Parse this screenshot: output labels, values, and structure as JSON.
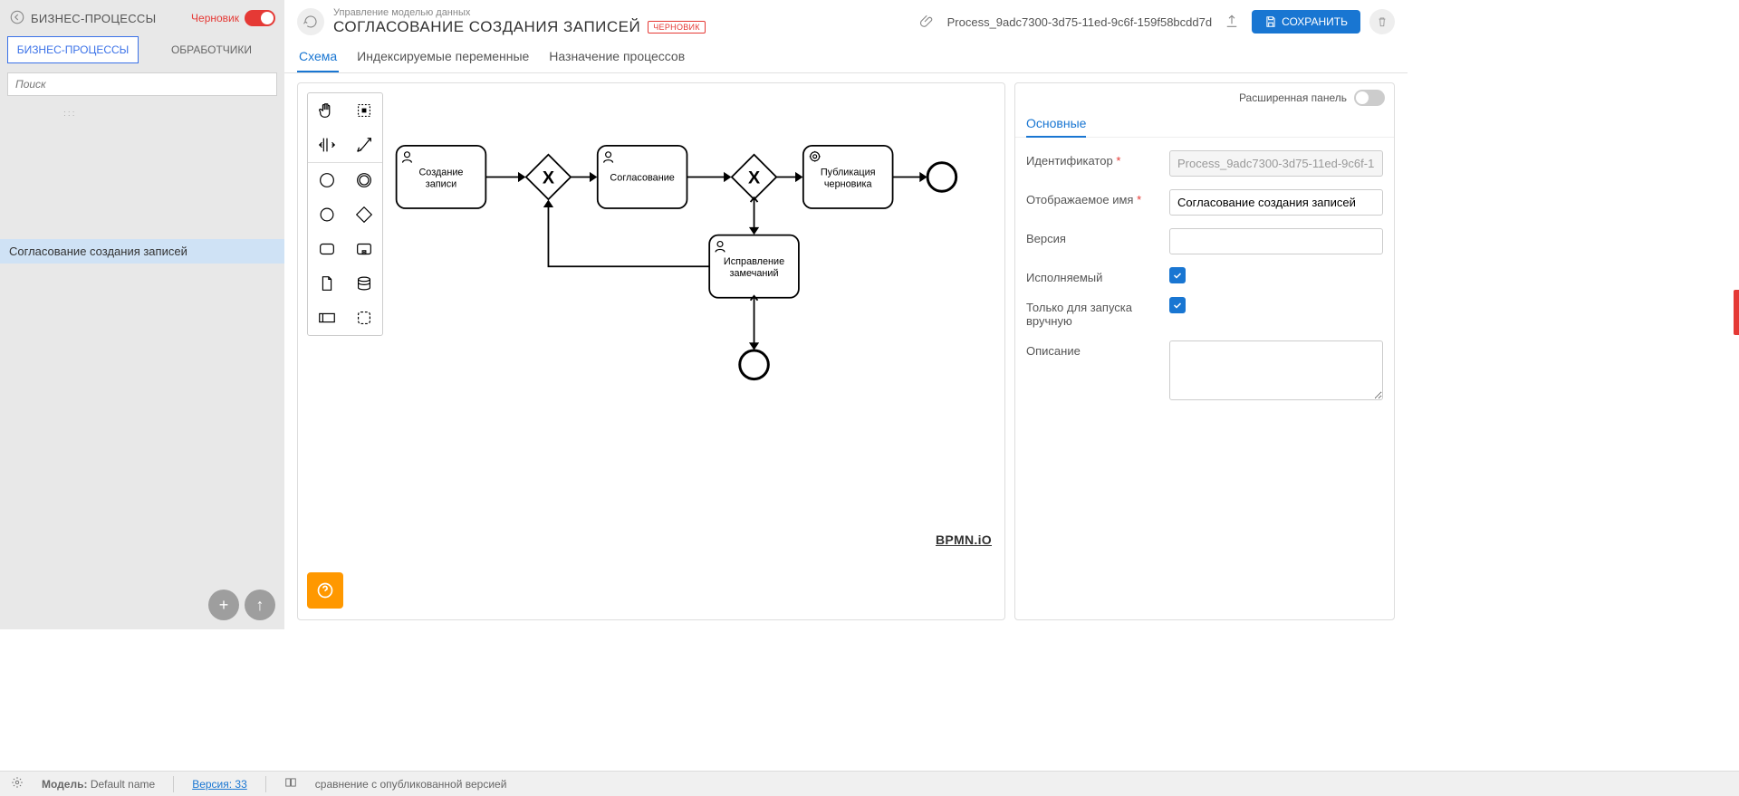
{
  "sidebar": {
    "title": "БИЗНЕС-ПРОЦЕССЫ",
    "draft_label": "Черновик",
    "tabs": [
      "БИЗНЕС-ПРОЦЕССЫ",
      "ОБРАБОТЧИКИ"
    ],
    "search_placeholder": "Поиск",
    "tree_items": [
      "Согласование создания записей"
    ]
  },
  "header": {
    "breadcrumb": "Управление моделью данных",
    "title": "СОГЛАСОВАНИЕ СОЗДАНИЯ ЗАПИСЕЙ",
    "badge": "ЧЕРНОВИК",
    "process_file": "Process_9adc7300-3d75-11ed-9c6f-159f58bcdd7d",
    "save": "СОХРАНИТЬ"
  },
  "tabs": [
    "Схема",
    "Индексируемые переменные",
    "Назначение процессов"
  ],
  "palette_tooltips": {
    "hand": "hand-tool",
    "lasso": "lasso-tool",
    "space": "space-tool",
    "connect": "global-connect-tool",
    "start-event": "start-event",
    "end-event": "end-event",
    "intermediate-event": "intermediate-event",
    "gateway": "gateway",
    "task": "task",
    "subprocess": "subprocess",
    "data-object": "data-object",
    "data-store": "data-store",
    "participant": "participant",
    "group": "group"
  },
  "bpmn": {
    "nodes": {
      "task1_l1": "Создание",
      "task1_l2": "записи",
      "task2_l1": "Согласование",
      "task3_l1": "Публикация",
      "task3_l2": "черновика",
      "task4_l1": "Исправление",
      "task4_l2": "замечаний"
    },
    "logo": "BPMN.iO"
  },
  "props": {
    "panel_toggle_label": "Расширенная панель",
    "section_title": "Основные",
    "labels": {
      "id": "Идентификатор",
      "display_name": "Отображаемое имя",
      "version": "Версия",
      "executable": "Исполняемый",
      "manual_only_l1": "Только для запуска",
      "manual_only_l2": "вручную",
      "description": "Описание"
    },
    "values": {
      "id": "Process_9adc7300-3d75-11ed-9c6f-15...",
      "display_name": "Согласование создания записей",
      "version": ""
    }
  },
  "bottombar": {
    "model_label": "Модель:",
    "model_value": "Default name",
    "version_label": "Версия:",
    "version_value": "33",
    "compare": "сравнение с опубликованной версией"
  }
}
